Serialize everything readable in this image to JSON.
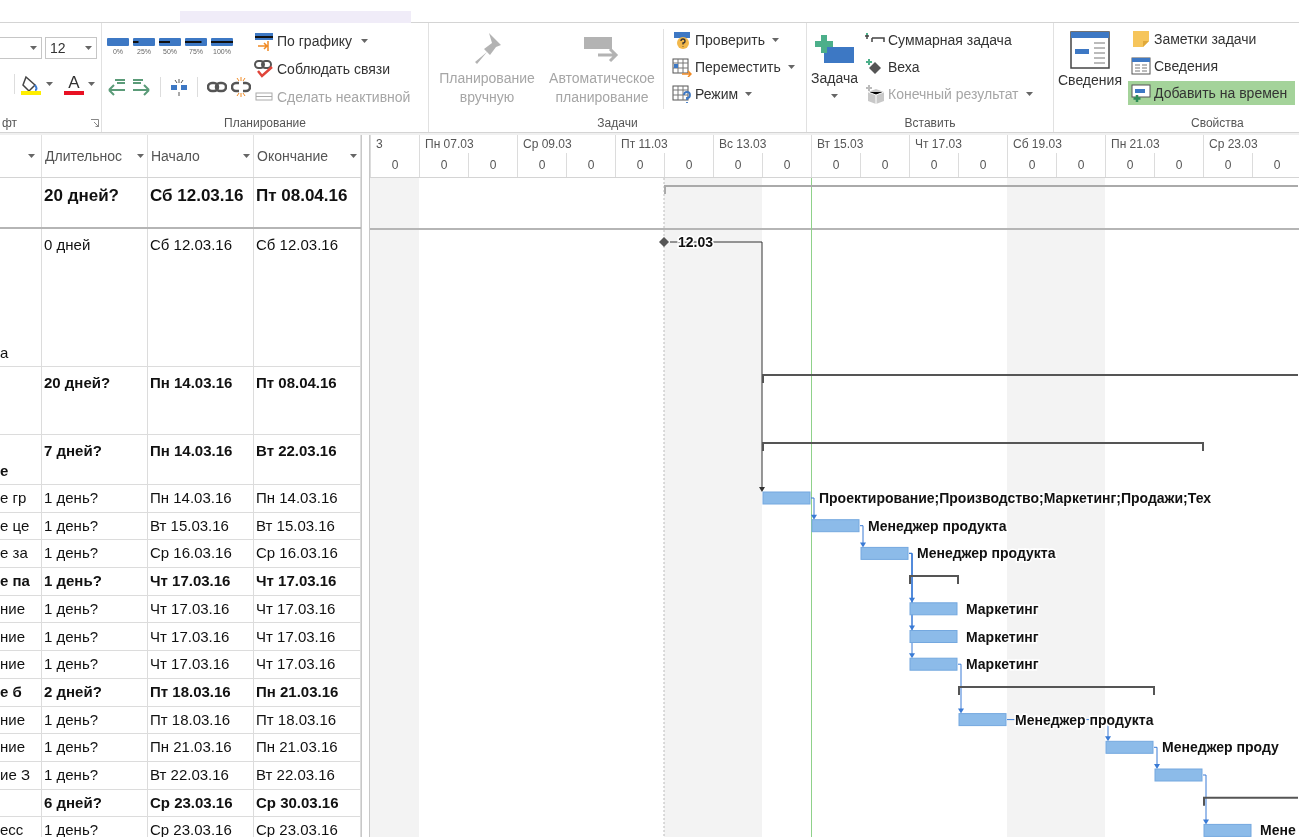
{
  "ribbon": {
    "font": {
      "label": "фт",
      "font_size": "12",
      "font_color_glyph": "A"
    },
    "planning": {
      "label": "Планирование",
      "percent_buttons": [
        "0%",
        "25%",
        "50%",
        "75%",
        "100%"
      ],
      "buttons": [
        {
          "label": "По графику",
          "dropdown": true,
          "disabled": false
        },
        {
          "label": "Соблюдать связи",
          "dropdown": false,
          "disabled": false
        },
        {
          "label": "Сделать неактивной",
          "dropdown": false,
          "disabled": true
        }
      ]
    },
    "tasks": {
      "label": "Задачи",
      "large": [
        {
          "label": "Планирование вручную",
          "disabled": true
        },
        {
          "label": "Автоматическое планирование",
          "disabled": true
        }
      ],
      "buttons": [
        {
          "label": "Проверить",
          "dropdown": true,
          "disabled": false
        },
        {
          "label": "Переместить",
          "dropdown": true,
          "disabled": false
        },
        {
          "label": "Режим",
          "dropdown": true,
          "disabled": false
        }
      ]
    },
    "insert": {
      "label": "Вставить",
      "large": {
        "label": "Задача",
        "dropdown": true
      },
      "buttons": [
        {
          "label": "Суммарная задача",
          "dropdown": false,
          "disabled": false
        },
        {
          "label": "Веха",
          "dropdown": false,
          "disabled": false
        },
        {
          "label": "Конечный результат",
          "dropdown": true,
          "disabled": true
        }
      ]
    },
    "properties": {
      "label": "Свойства",
      "large": {
        "label": "Сведения"
      },
      "buttons": [
        {
          "label": "Заметки задачи",
          "selected": false
        },
        {
          "label": "Сведения",
          "selected": false
        },
        {
          "label": "Добавить на времен",
          "selected": true
        }
      ]
    }
  },
  "table": {
    "columns": [
      {
        "label": "Длительнос"
      },
      {
        "label": "Начало"
      },
      {
        "label": "Окончание"
      }
    ],
    "rows": [
      {
        "kind": "project",
        "duration": "20 дней?",
        "start": "Сб 12.03.16",
        "finish": "Пт 08.04.16"
      },
      {
        "kind": "milestone",
        "name": "а",
        "duration": "0 дней",
        "start": "Сб 12.03.16",
        "finish": "Сб 12.03.16",
        "bar_label": "12.03"
      },
      {
        "kind": "summary",
        "duration": "20 дней?",
        "start": "Пн 14.03.16",
        "finish": "Пт 08.04.16"
      },
      {
        "kind": "summary",
        "name": "е",
        "duration": "7 дней?",
        "start": "Пн 14.03.16",
        "finish": "Вт 22.03.16"
      },
      {
        "kind": "task",
        "name": "е гр",
        "duration": "1 день?",
        "start": "Пн 14.03.16",
        "finish": "Пн 14.03.16",
        "bar_label": "Проектирование;Производство;Маркетинг;Продажи;Тех"
      },
      {
        "kind": "task",
        "name": "е це",
        "duration": "1 день?",
        "start": "Вт 15.03.16",
        "finish": "Вт 15.03.16",
        "bar_label": "Менеджер продукта"
      },
      {
        "kind": "task",
        "name": "е за",
        "duration": "1 день?",
        "start": "Ср 16.03.16",
        "finish": "Ср 16.03.16",
        "bar_label": "Менеджер продукта"
      },
      {
        "kind": "summary",
        "name": "е па",
        "duration": "1 день?",
        "start": "Чт 17.03.16",
        "finish": "Чт 17.03.16"
      },
      {
        "kind": "task",
        "name": "ние",
        "duration": "1 день?",
        "start": "Чт 17.03.16",
        "finish": "Чт 17.03.16",
        "bar_label": "Маркетинг"
      },
      {
        "kind": "task",
        "name": "ние",
        "duration": "1 день?",
        "start": "Чт 17.03.16",
        "finish": "Чт 17.03.16",
        "bar_label": "Маркетинг"
      },
      {
        "kind": "task",
        "name": "ние",
        "duration": "1 день?",
        "start": "Чт 17.03.16",
        "finish": "Чт 17.03.16",
        "bar_label": "Маркетинг"
      },
      {
        "kind": "summary",
        "name": "е б",
        "duration": "2 дней?",
        "start": "Пт 18.03.16",
        "finish": "Пн 21.03.16"
      },
      {
        "kind": "task",
        "name": "ние",
        "duration": "1 день?",
        "start": "Пт 18.03.16",
        "finish": "Пт 18.03.16",
        "bar_label": "Менеджер продукта"
      },
      {
        "kind": "task",
        "name": "ние",
        "duration": "1 день?",
        "start": "Пн 21.03.16",
        "finish": "Пн 21.03.16",
        "bar_label": "Менеджер проду"
      },
      {
        "kind": "task",
        "name": "ие З",
        "duration": "1 день?",
        "start": "Вт 22.03.16",
        "finish": "Вт 22.03.16"
      },
      {
        "kind": "summary",
        "duration": "6 дней?",
        "start": "Ср 23.03.16",
        "finish": "Ср 30.03.16"
      },
      {
        "kind": "task",
        "name": "есс",
        "duration": "1 день?",
        "start": "Ср 23.03.16",
        "finish": "Ср 23.03.16",
        "bar_label": "Мене"
      }
    ]
  },
  "timescale": {
    "major": [
      "3",
      "Пн 07.03",
      "Ср 09.03",
      "Пт 11.03",
      "Вс 13.03",
      "Вт 15.03",
      "Чт 17.03",
      "Сб 19.03",
      "Пн 21.03",
      "Ср 23.03"
    ],
    "minor": [
      "0",
      "0",
      "0",
      "0",
      "0",
      "0",
      "0",
      "0",
      "0",
      "0",
      "0",
      "0",
      "0",
      "0",
      "0",
      "0",
      "0",
      "0",
      "0"
    ]
  }
}
